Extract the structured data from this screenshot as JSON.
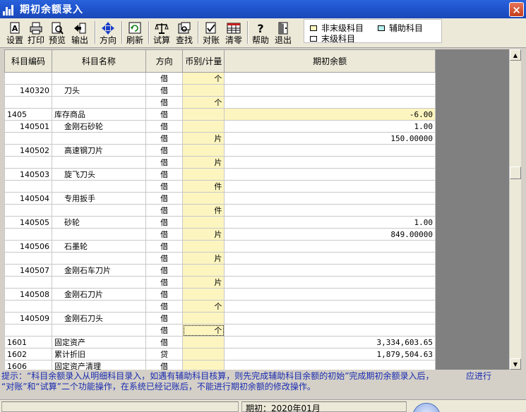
{
  "window": {
    "title": "期初余额录入",
    "close": "×"
  },
  "toolbar": {
    "buttons": [
      {
        "id": "setup",
        "label": "设置"
      },
      {
        "id": "print",
        "label": "打印"
      },
      {
        "id": "preview",
        "label": "预览"
      },
      {
        "id": "export",
        "label": "输出"
      },
      {
        "id": "direction",
        "label": "方向"
      },
      {
        "id": "refresh",
        "label": "刷新"
      },
      {
        "id": "trial",
        "label": "试算"
      },
      {
        "id": "find",
        "label": "查找"
      },
      {
        "id": "reconcile",
        "label": "对账"
      },
      {
        "id": "clear",
        "label": "清零"
      },
      {
        "id": "help",
        "label": "帮助"
      },
      {
        "id": "exit",
        "label": "退出"
      }
    ]
  },
  "legend": {
    "nonleaf": {
      "label": "非末级科目",
      "color": "#fdf5bf"
    },
    "auxiliary": {
      "label": "辅助科目",
      "color": "#b8f0f0"
    },
    "leaf": {
      "label": "末级科目",
      "color": "#ffffff"
    }
  },
  "table": {
    "headers": [
      "科目编码",
      "科目名称",
      "方向",
      "币别/计量",
      "期初余额"
    ],
    "rows": [
      {
        "code": "",
        "name": "",
        "dir": "借",
        "unit": "个",
        "amount": ""
      },
      {
        "code": "140320",
        "name": "刀头",
        "dir": "借",
        "unit": "",
        "amount": ""
      },
      {
        "code": "",
        "name": "",
        "dir": "借",
        "unit": "个",
        "amount": ""
      },
      {
        "code": "1405",
        "name": "库存商品",
        "dir": "借",
        "unit": "",
        "amount": "-6.00",
        "highlight": true
      },
      {
        "code": "140501",
        "name": "金刚石砂轮",
        "dir": "借",
        "unit": "",
        "amount": "1.00"
      },
      {
        "code": "",
        "name": "",
        "dir": "借",
        "unit": "片",
        "amount": "150.00000"
      },
      {
        "code": "140502",
        "name": "高速钢刀片",
        "dir": "借",
        "unit": "",
        "amount": ""
      },
      {
        "code": "",
        "name": "",
        "dir": "借",
        "unit": "片",
        "amount": ""
      },
      {
        "code": "140503",
        "name": "旋飞刀头",
        "dir": "借",
        "unit": "",
        "amount": ""
      },
      {
        "code": "",
        "name": "",
        "dir": "借",
        "unit": "件",
        "amount": ""
      },
      {
        "code": "140504",
        "name": "专用扳手",
        "dir": "借",
        "unit": "",
        "amount": ""
      },
      {
        "code": "",
        "name": "",
        "dir": "借",
        "unit": "件",
        "amount": ""
      },
      {
        "code": "140505",
        "name": "砂轮",
        "dir": "借",
        "unit": "",
        "amount": "1.00"
      },
      {
        "code": "",
        "name": "",
        "dir": "借",
        "unit": "片",
        "amount": "849.00000"
      },
      {
        "code": "140506",
        "name": "石墨轮",
        "dir": "借",
        "unit": "",
        "amount": ""
      },
      {
        "code": "",
        "name": "",
        "dir": "借",
        "unit": "片",
        "amount": ""
      },
      {
        "code": "140507",
        "name": "金刚石车刀片",
        "dir": "借",
        "unit": "",
        "amount": ""
      },
      {
        "code": "",
        "name": "",
        "dir": "借",
        "unit": "片",
        "amount": ""
      },
      {
        "code": "140508",
        "name": "金刚石刀片",
        "dir": "借",
        "unit": "",
        "amount": ""
      },
      {
        "code": "",
        "name": "",
        "dir": "借",
        "unit": "个",
        "amount": ""
      },
      {
        "code": "140509",
        "name": "金刚石刀头",
        "dir": "借",
        "unit": "",
        "amount": ""
      },
      {
        "code": "",
        "name": "",
        "dir": "借",
        "unit": "个",
        "amount": "",
        "focus": true
      },
      {
        "code": "1601",
        "name": "固定资产",
        "dir": "借",
        "unit": "",
        "amount": "3,334,603.65"
      },
      {
        "code": "1602",
        "name": "累计折旧",
        "dir": "贷",
        "unit": "",
        "amount": "1,879,504.63"
      },
      {
        "code": "1606",
        "name": "固定资产清理",
        "dir": "借",
        "unit": "",
        "amount": ""
      }
    ]
  },
  "hint": {
    "line1": "提示：“科目余额录入从明细科目录入，如遇有辅助科目核算，则先完成辅助科目余额的初始”完成期初余额录入后，",
    "tail": "应进行",
    "line2": "“对账”和“试算”二个功能操作，在系统已经记账后，不能进行期初余额的修改操作。"
  },
  "status": {
    "period": "期初：2020年01月"
  }
}
